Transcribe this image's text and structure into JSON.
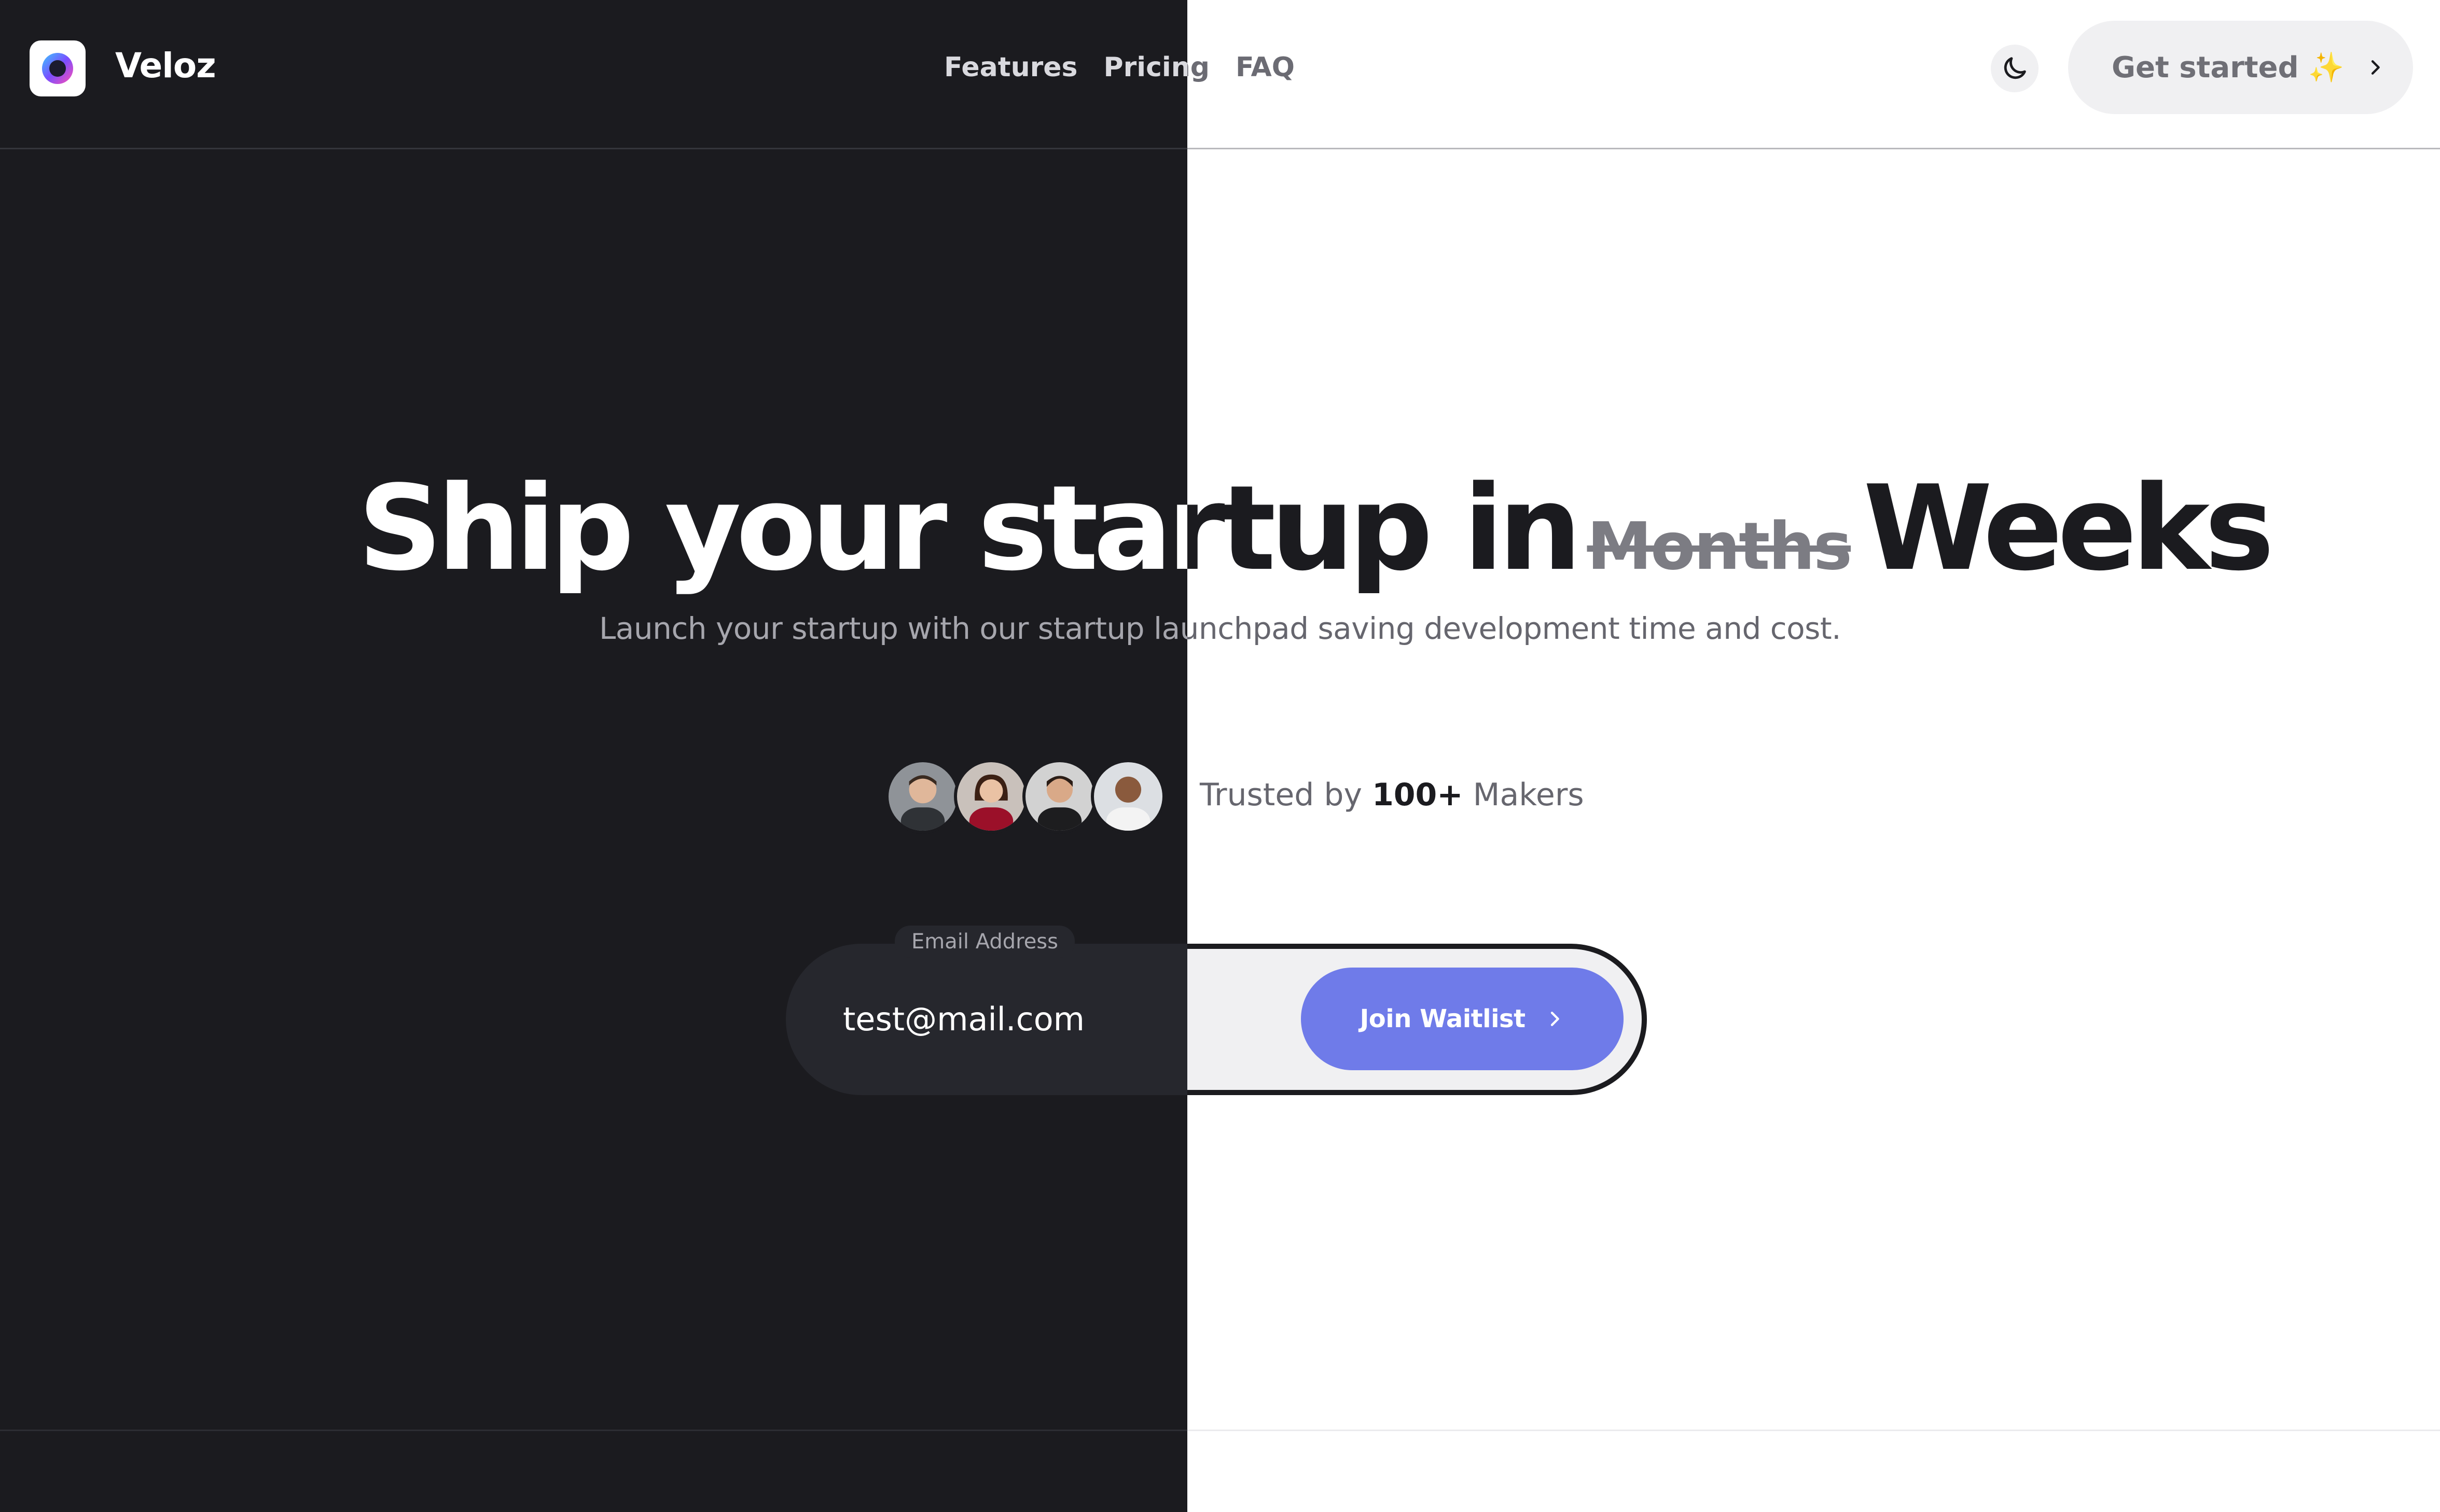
{
  "brand": {
    "name": "Veloz"
  },
  "nav": {
    "features": "Features",
    "pricing": "Pricing",
    "faq": "FAQ"
  },
  "header": {
    "cta_label": "Get started",
    "cta_emoji": "✨"
  },
  "hero": {
    "headline_prefix": "Ship your startup in",
    "headline_struck": "Months",
    "headline_suffix": "Weeks",
    "subheadline": "Launch your startup with our startup launchpad saving development time and cost."
  },
  "social_proof": {
    "prefix": "Trusted by",
    "count": "100+",
    "suffix": "Makers"
  },
  "waitlist": {
    "label": "Email Address",
    "value": "test@mail.com",
    "button_label": "Join Waitlist"
  },
  "icons": {
    "logo": "logo-icon",
    "theme_toggle": "moon-icon",
    "cta_chevron": "chevron-right-icon",
    "join_chevron": "chevron-right-icon"
  },
  "colors": {
    "dark_background": "#1b1b1f",
    "light_background": "#ffffff",
    "accent": "#6f7be9"
  }
}
